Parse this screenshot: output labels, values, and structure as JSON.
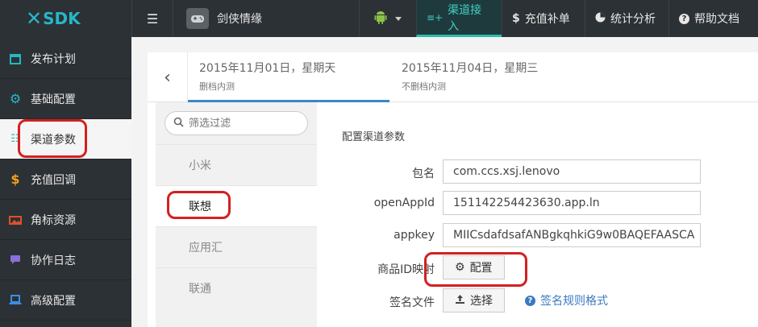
{
  "app": {
    "logo_mark": "✕",
    "logo_text": "SDK"
  },
  "header": {
    "project_name": "剑侠情缘",
    "tabs": [
      {
        "label": "渠道接入",
        "icon": "list-plus-icon",
        "active": true
      },
      {
        "label": "充值补单",
        "icon": "dollar-icon"
      },
      {
        "label": "统计分析",
        "icon": "pie-chart-icon"
      },
      {
        "label": "帮助文档",
        "icon": "help-icon"
      }
    ]
  },
  "sidebar": {
    "items": [
      {
        "label": "发布计划",
        "icon": "calendar-icon",
        "color": "#25b7c6"
      },
      {
        "label": "基础配置",
        "icon": "gear-icon",
        "color": "#25b7c6"
      },
      {
        "label": "渠道参数",
        "icon": "list-icon",
        "color": "#2bbcae",
        "active": true
      },
      {
        "label": "充值回调",
        "icon": "dollar-icon",
        "color": "#f0a020"
      },
      {
        "label": "角标资源",
        "icon": "image-icon",
        "color": "#e0502a"
      },
      {
        "label": "协作日志",
        "icon": "chat-icon",
        "color": "#8a6fd6"
      },
      {
        "label": "高级配置",
        "icon": "laptop-icon",
        "color": "#3a8fe0"
      }
    ]
  },
  "dates": [
    {
      "date": "2015年11月01日，星期天",
      "sub": "删档内测",
      "active": true
    },
    {
      "date": "2015年11月04日，星期三",
      "sub": "不删档内测"
    }
  ],
  "channels": {
    "search_placeholder": "筛选过滤",
    "items": [
      "小米",
      "联想",
      "应用汇",
      "联通"
    ],
    "active": "联想"
  },
  "config": {
    "title": "配置渠道参数",
    "fields": [
      {
        "label": "包名",
        "value": "com.ccs.xsj.lenovo"
      },
      {
        "label": "openAppId",
        "value": "151142254423630.app.ln"
      },
      {
        "label": "appkey",
        "value": "MIICsdafdsafANBgkqhkiG9w0BAQEFAASCA"
      }
    ],
    "product_map": {
      "label": "商品ID映射",
      "button": "配置"
    },
    "sign_file": {
      "label": "签名文件",
      "button": "选择",
      "help_link": "签名规则格式"
    }
  },
  "colors": {
    "accent": "#2bbcae",
    "highlight": "#d32020",
    "link": "#3a79c1"
  }
}
